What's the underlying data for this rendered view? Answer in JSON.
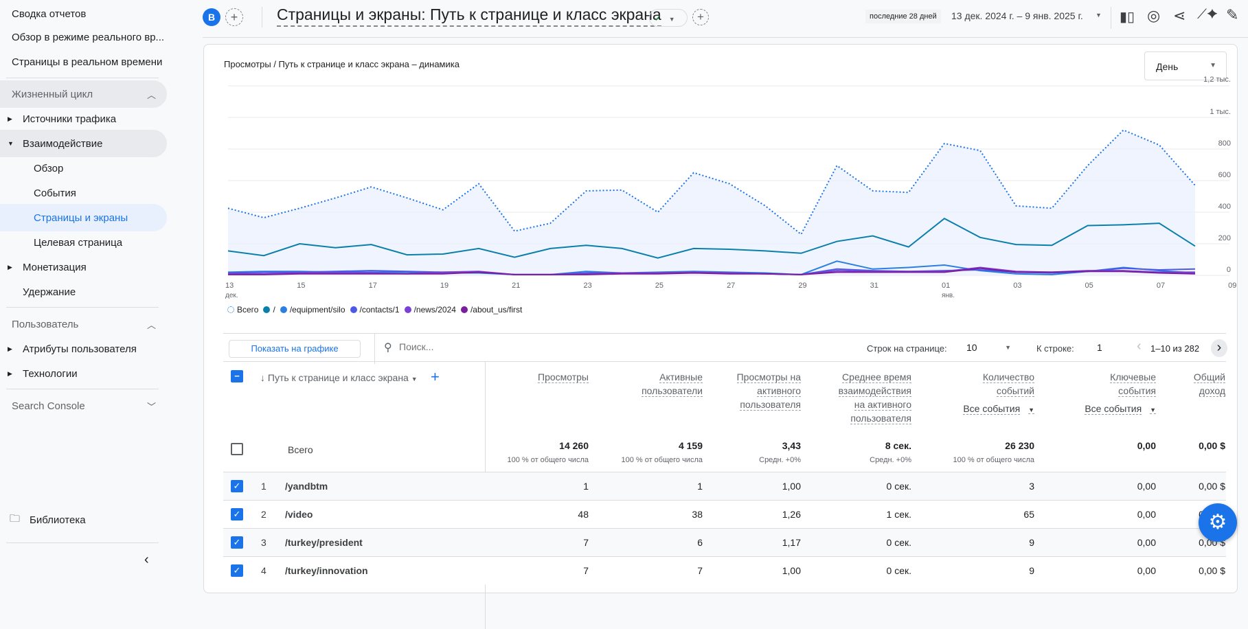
{
  "sidebar": {
    "top_items": [
      "Сводка отчетов",
      "Обзор в режиме реального вр...",
      "Страницы в реальном времени"
    ],
    "lifecycle": "Жизненный цикл",
    "traffic": "Источники трафика",
    "engagement": "Взаимодействие",
    "engagement_items": [
      "Обзор",
      "События",
      "Страницы и экраны",
      "Целевая страница"
    ],
    "monetization": "Монетизация",
    "retention": "Удержание",
    "user": "Пользователь",
    "user_attrs": "Атрибуты пользователя",
    "tech": "Технологии",
    "search_console": "Search Console",
    "library": "Библиотека"
  },
  "header": {
    "avatar": "B",
    "title": "Страницы и экраны: Путь к странице и класс экрана",
    "date_badge": "последние 28 дней",
    "date_range": "13 дек. 2024 г. – 9 янв. 2025 г."
  },
  "chart_card": {
    "title": "Просмотры / Путь к странице и класс экрана – динамика",
    "granularity": "День"
  },
  "chart_data": {
    "type": "line",
    "x": [
      "13 дек.",
      "14",
      "15",
      "16",
      "17",
      "18",
      "19",
      "20",
      "21",
      "22",
      "23",
      "24",
      "25",
      "26",
      "27",
      "28",
      "29",
      "30",
      "31",
      "01 янв.",
      "02",
      "03",
      "04",
      "05",
      "06",
      "07",
      "08",
      "09"
    ],
    "x_tick_labels": [
      [
        "13",
        "дек."
      ],
      [
        "15",
        ""
      ],
      [
        "17",
        ""
      ],
      [
        "19",
        ""
      ],
      [
        "21",
        ""
      ],
      [
        "23",
        ""
      ],
      [
        "25",
        ""
      ],
      [
        "27",
        ""
      ],
      [
        "29",
        ""
      ],
      [
        "31",
        ""
      ],
      [
        "01",
        "янв."
      ],
      [
        "03",
        ""
      ],
      [
        "05",
        ""
      ],
      [
        "07",
        ""
      ],
      [
        "09",
        ""
      ]
    ],
    "ylim": [
      0,
      1200
    ],
    "y_ticks": [
      0,
      200,
      400,
      600,
      800,
      1000,
      1200
    ],
    "y_tick_labels": [
      "0",
      "200",
      "400",
      "600",
      "800",
      "1 тыс.",
      "1,2 тыс."
    ],
    "grid": true,
    "legend_position": "bottom-left",
    "series": [
      {
        "name": "Всего",
        "color": "#1a73e8",
        "style": "dotted-area",
        "values": [
          425,
          365,
          425,
          490,
          560,
          490,
          415,
          580,
          280,
          330,
          535,
          540,
          400,
          650,
          580,
          440,
          260,
          695,
          535,
          525,
          835,
          790,
          440,
          425,
          695,
          920,
          825,
          570
        ]
      },
      {
        "name": "/",
        "color": "#0b7fab",
        "values": [
          155,
          125,
          200,
          175,
          195,
          130,
          135,
          170,
          115,
          170,
          190,
          170,
          110,
          170,
          165,
          155,
          140,
          215,
          250,
          180,
          360,
          240,
          195,
          190,
          315,
          320,
          330,
          185
        ]
      },
      {
        "name": "/equipment/silo",
        "color": "#2a7fe0",
        "values": [
          20,
          25,
          25,
          20,
          20,
          20,
          15,
          15,
          5,
          5,
          25,
          15,
          20,
          25,
          20,
          15,
          5,
          90,
          40,
          50,
          65,
          30,
          10,
          5,
          25,
          50,
          30,
          15
        ]
      },
      {
        "name": "/contacts/1",
        "color": "#4b5ae6",
        "values": [
          15,
          20,
          20,
          25,
          30,
          25,
          20,
          20,
          5,
          5,
          15,
          15,
          15,
          20,
          15,
          10,
          5,
          40,
          30,
          25,
          30,
          35,
          20,
          15,
          25,
          45,
          35,
          40
        ]
      },
      {
        "name": "/news/2024",
        "color": "#7b3fd6",
        "values": [
          10,
          10,
          15,
          15,
          15,
          10,
          20,
          25,
          5,
          5,
          10,
          15,
          15,
          20,
          15,
          10,
          5,
          30,
          25,
          25,
          25,
          50,
          25,
          20,
          30,
          30,
          20,
          20
        ]
      },
      {
        "name": "/about_us/first",
        "color": "#7a1e9e",
        "values": [
          5,
          5,
          10,
          10,
          10,
          10,
          10,
          20,
          5,
          5,
          5,
          10,
          10,
          15,
          10,
          10,
          5,
          20,
          20,
          20,
          20,
          45,
          20,
          20,
          25,
          25,
          15,
          10
        ]
      }
    ]
  },
  "toolbar": {
    "show_on_chart": "Показать на графике",
    "search_placeholder": "Поиск...",
    "rows_label": "Строк на странице:",
    "rows_value": "10",
    "goto_label": "К строке:",
    "goto_value": "1",
    "range": "1–10 из 282"
  },
  "table": {
    "dimension": "Путь к странице и класс экрана",
    "columns": [
      {
        "label": [
          "Просмотры"
        ]
      },
      {
        "label": [
          "Активные",
          "пользователи"
        ]
      },
      {
        "label": [
          "Просмотры на",
          "активного",
          "пользователя"
        ]
      },
      {
        "label": [
          "Среднее время",
          "взаимодействия",
          "на активного",
          "пользователя"
        ]
      },
      {
        "label": [
          "Количество",
          "событий"
        ],
        "filter": "Все события"
      },
      {
        "label": [
          "Ключевые",
          "события"
        ],
        "filter": "Все события"
      },
      {
        "label": [
          "Общий",
          "доход"
        ]
      }
    ],
    "total": {
      "label": "Всего",
      "values": [
        "14 260",
        "4 159",
        "3,43",
        "8 сек.",
        "26 230",
        "0,00",
        "0,00 $"
      ],
      "subs": [
        "100 % от общего числа",
        "100 % от общего числа",
        "Средн. +0%",
        "Средн. +0%",
        "100 % от общего числа",
        "",
        ""
      ]
    },
    "rows": [
      {
        "index": "1",
        "name": "/yandbtm",
        "values": [
          "1",
          "1",
          "1,00",
          "0 сек.",
          "3",
          "0,00",
          "0,00 $"
        ]
      },
      {
        "index": "2",
        "name": "/video",
        "values": [
          "48",
          "38",
          "1,26",
          "1 сек.",
          "65",
          "0,00",
          "0,00 $"
        ]
      },
      {
        "index": "3",
        "name": "/turkey/president",
        "values": [
          "7",
          "6",
          "1,17",
          "0 сек.",
          "9",
          "0,00",
          "0,00 $"
        ]
      },
      {
        "index": "4",
        "name": "/turkey/innovation",
        "values": [
          "7",
          "7",
          "1,00",
          "0 сек.",
          "9",
          "0,00",
          "0,00 $"
        ]
      }
    ]
  }
}
